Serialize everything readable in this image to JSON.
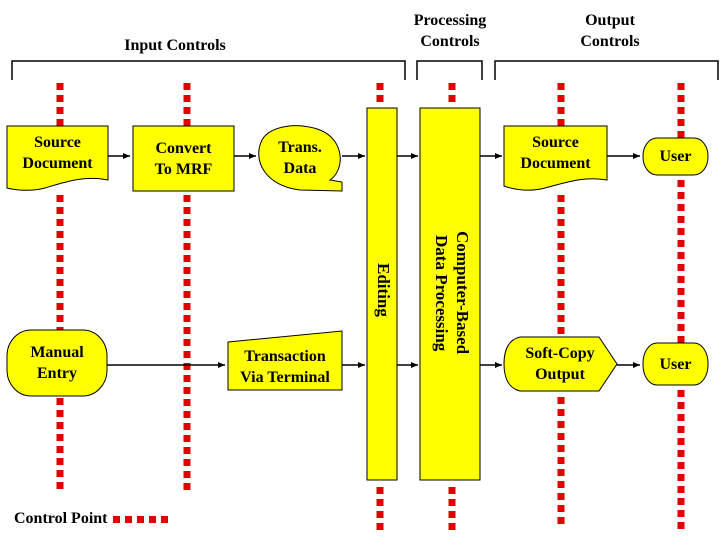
{
  "headers": {
    "input": "Input Controls",
    "processing": [
      "Processing",
      "Controls"
    ],
    "output": [
      "Output",
      "Controls"
    ]
  },
  "nodes": {
    "source_document_in": [
      "Source",
      "Document"
    ],
    "convert_mrf": [
      "Convert",
      "To MRF"
    ],
    "trans_data": [
      "Trans.",
      "Data"
    ],
    "editing": "Editing",
    "computer_processing": [
      "Computer-Based",
      "Data Processing"
    ],
    "source_document_out": [
      "Source",
      "Document"
    ],
    "user_top": "User",
    "manual_entry": [
      "Manual",
      "Entry"
    ],
    "transaction_terminal": [
      "Transaction",
      "Via Terminal"
    ],
    "soft_copy": [
      "Soft-Copy",
      "Output"
    ],
    "user_bottom": "User"
  },
  "legend": {
    "label": "Control Point"
  },
  "colors": {
    "node_fill": "#ffff00",
    "control_point": "#e00000",
    "stroke": "#000000"
  }
}
